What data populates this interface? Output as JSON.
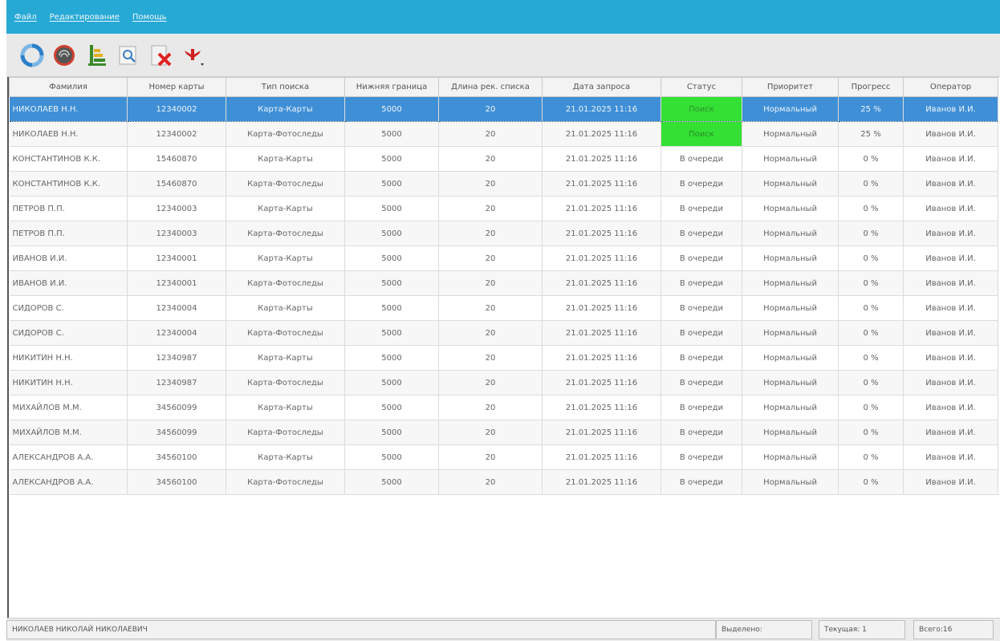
{
  "menu": [
    "Файл",
    "Редактирование",
    "Помощь"
  ],
  "toolbar": {
    "colors": {
      "refresh": "#2b7fc8",
      "delete": "#e02020",
      "accent": "#27a9d6"
    }
  },
  "columns": [
    "Фамилия",
    "Номер карты",
    "Тип поиска",
    "Нижняя граница",
    "Длина рек. списка",
    "Дата запроса",
    "Статус",
    "Приоритет",
    "Прогресс",
    "Оператор"
  ],
  "rows": [
    [
      "НИКОЛАЕВ Н.Н.",
      "12340002",
      "Карта-Карты",
      "5000",
      "20",
      "21.01.2025 11:16",
      "Поиск",
      "Нормальный",
      "25 %",
      "Иванов И.И."
    ],
    [
      "НИКОЛАЕВ Н.Н.",
      "12340002",
      "Карта-Фотоследы",
      "5000",
      "20",
      "21.01.2025 11:16",
      "Поиск",
      "Нормальный",
      "25 %",
      "Иванов И.И."
    ],
    [
      "КОНСТАНТИНОВ К.К.",
      "15460870",
      "Карта-Карты",
      "5000",
      "20",
      "21.01.2025 11:16",
      "В очереди",
      "Нормальный",
      "0 %",
      "Иванов И.И."
    ],
    [
      "КОНСТАНТИНОВ К.К.",
      "15460870",
      "Карта-Фотоследы",
      "5000",
      "20",
      "21.01.2025 11:16",
      "В очереди",
      "Нормальный",
      "0 %",
      "Иванов И.И."
    ],
    [
      "ПЕТРОВ П.П.",
      "12340003",
      "Карта-Карты",
      "5000",
      "20",
      "21.01.2025 11:16",
      "В очереди",
      "Нормальный",
      "0 %",
      "Иванов И.И."
    ],
    [
      "ПЕТРОВ П.П.",
      "12340003",
      "Карта-Фотоследы",
      "5000",
      "20",
      "21.01.2025 11:16",
      "В очереди",
      "Нормальный",
      "0 %",
      "Иванов И.И."
    ],
    [
      "ИВАНОВ И.И.",
      "12340001",
      "Карта-Карты",
      "5000",
      "20",
      "21.01.2025 11:16",
      "В очереди",
      "Нормальный",
      "0 %",
      "Иванов И.И."
    ],
    [
      "ИВАНОВ И.И.",
      "12340001",
      "Карта-Фотоследы",
      "5000",
      "20",
      "21.01.2025 11:16",
      "В очереди",
      "Нормальный",
      "0 %",
      "Иванов И.И."
    ],
    [
      "СИДОРОВ С.",
      "12340004",
      "Карта-Карты",
      "5000",
      "20",
      "21.01.2025 11:16",
      "В очереди",
      "Нормальный",
      "0 %",
      "Иванов И.И."
    ],
    [
      "СИДОРОВ С.",
      "12340004",
      "Карта-Фотоследы",
      "5000",
      "20",
      "21.01.2025 11:16",
      "В очереди",
      "Нормальный",
      "0 %",
      "Иванов И.И."
    ],
    [
      "НИКИТИН Н.Н.",
      "12340987",
      "Карта-Карты",
      "5000",
      "20",
      "21.01.2025 11:16",
      "В очереди",
      "Нормальный",
      "0 %",
      "Иванов И.И."
    ],
    [
      "НИКИТИН Н.Н.",
      "12340987",
      "Карта-Фотоследы",
      "5000",
      "20",
      "21.01.2025 11:16",
      "В очереди",
      "Нормальный",
      "0 %",
      "Иванов И.И."
    ],
    [
      "МИХАЙЛОВ М.М.",
      "34560099",
      "Карта-Карты",
      "5000",
      "20",
      "21.01.2025 11:16",
      "В очереди",
      "Нормальный",
      "0 %",
      "Иванов И.И."
    ],
    [
      "МИХАЙЛОВ М.М.",
      "34560099",
      "Карта-Фотоследы",
      "5000",
      "20",
      "21.01.2025 11:16",
      "В очереди",
      "Нормальный",
      "0 %",
      "Иванов И.И."
    ],
    [
      "АЛЕКСАНДРОВ А.А.",
      "34560100",
      "Карта-Карты",
      "5000",
      "20",
      "21.01.2025 11:16",
      "В очереди",
      "Нормальный",
      "0 %",
      "Иванов И.И."
    ],
    [
      "АЛЕКСАНДРОВ А.А.",
      "34560100",
      "Карта-Фотоследы",
      "5000",
      "20",
      "21.01.2025 11:16",
      "В очереди",
      "Нормальный",
      "0 %",
      "Иванов И.И."
    ]
  ],
  "status_search_color": "#33e033",
  "statusbar": {
    "person": "НИКОЛАЕВ НИКОЛАЙ НИКОЛАЕВИЧ",
    "selected": "Выделено:",
    "current": "Текущая: 1",
    "total": "Всего:16"
  }
}
